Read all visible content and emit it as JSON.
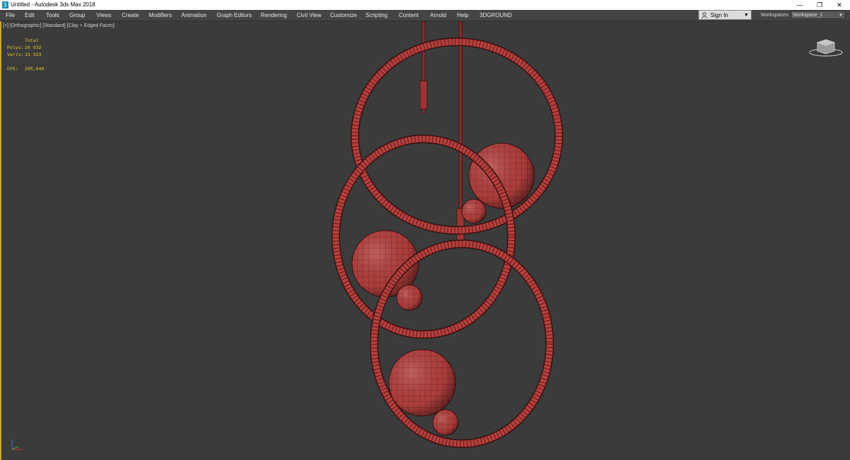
{
  "window": {
    "title": "Untitled - Autodesk 3ds Max 2018",
    "minimize": "—",
    "restore": "❐",
    "close": "✕"
  },
  "menu": [
    "File",
    "Edit",
    "Tools",
    "Group",
    "Views",
    "Create",
    "Modifiers",
    "Animation",
    "Graph Editors",
    "Rendering",
    "Civil View",
    "Customize",
    "Scripting",
    "Content",
    "Arnold",
    "Help",
    "3DGROUND"
  ],
  "signin": {
    "label": "Sign In"
  },
  "workspaces": {
    "label": "Workspaces:",
    "value": "Workspace_1"
  },
  "viewport": {
    "label_plus": "[+]",
    "label_view": "[Orthographic]",
    "label_shading": "[Standard]",
    "label_mode": "[Clay + Edged Faces]",
    "stats": {
      "header": "Total",
      "polys_label": "Polys:",
      "polys": "26 632",
      "verts_label": "Verts:",
      "verts": "13 523",
      "fps_label": "FPS:",
      "fps": "205,040"
    }
  },
  "colors": {
    "accent": "#c9a637",
    "stats": "#e7c92d",
    "model": "#b03a3a"
  },
  "icons": [
    "app-icon",
    "user-icon",
    "viewcube-icon",
    "axis-tripod-icon"
  ]
}
